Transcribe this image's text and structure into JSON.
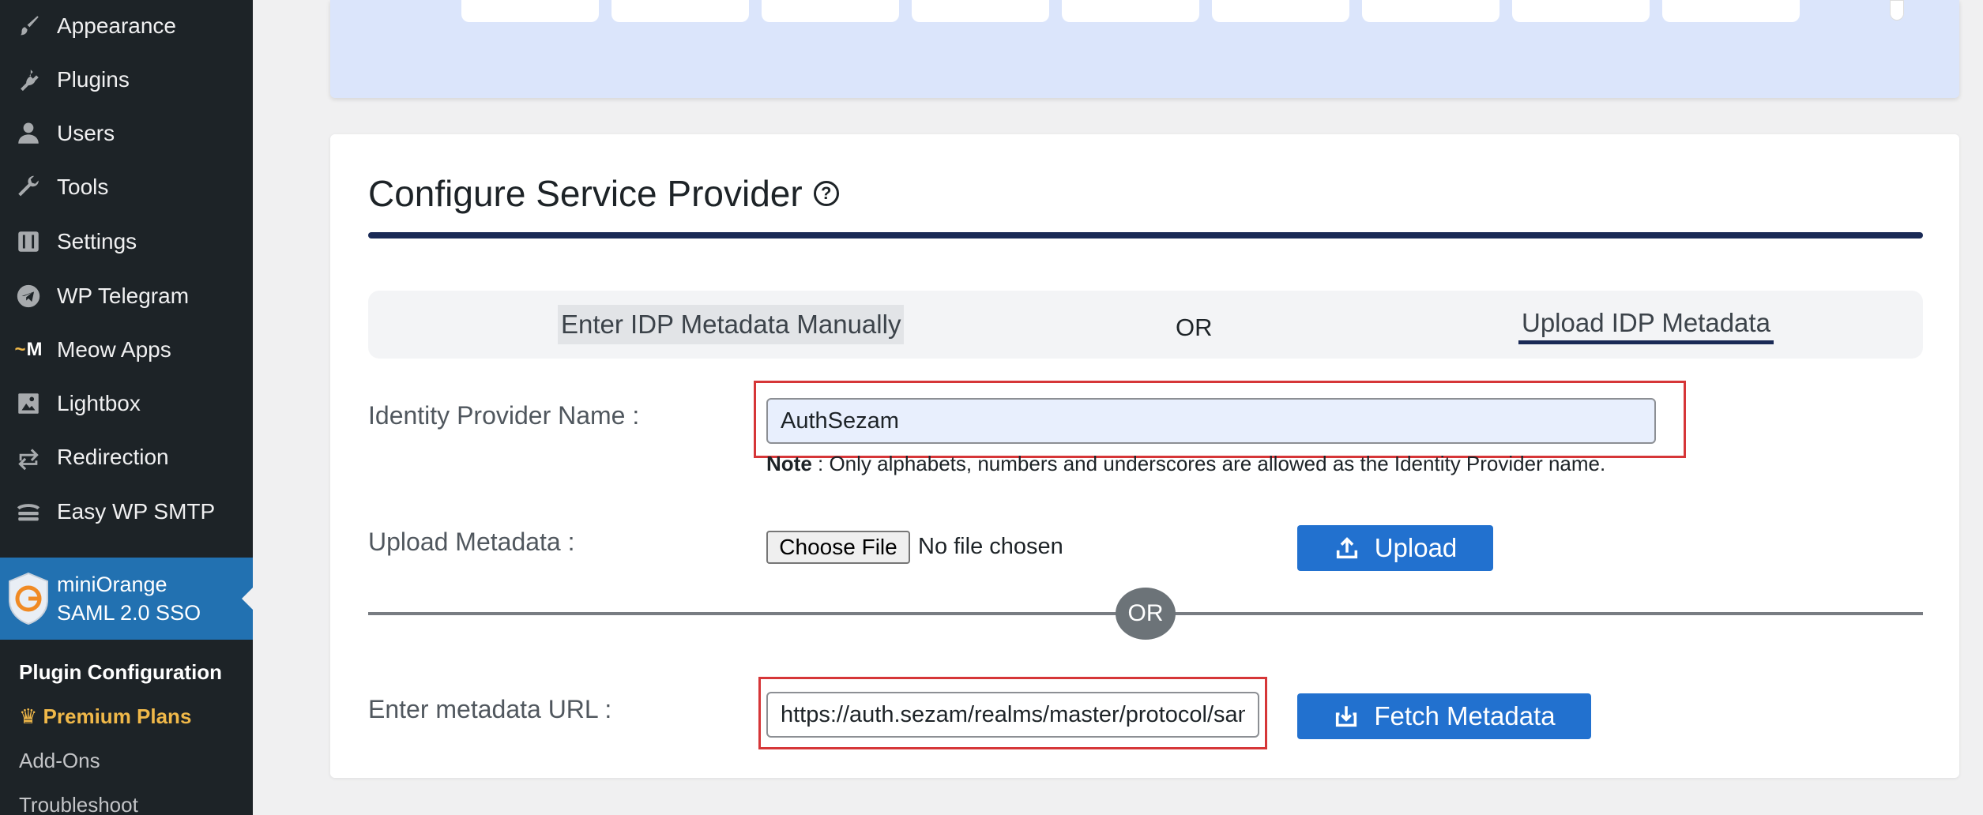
{
  "sidebar": {
    "items": [
      {
        "label": "Appearance",
        "icon": "brush-icon"
      },
      {
        "label": "Plugins",
        "icon": "plugin-icon"
      },
      {
        "label": "Users",
        "icon": "users-icon"
      },
      {
        "label": "Tools",
        "icon": "wrench-icon"
      },
      {
        "label": "Settings",
        "icon": "settings-icon"
      },
      {
        "label": "WP Telegram",
        "icon": "telegram-icon"
      },
      {
        "label": "Meow Apps",
        "icon": "meow-icon"
      },
      {
        "label": "Lightbox",
        "icon": "image-icon"
      },
      {
        "label": "Redirection",
        "icon": "redirect-icon"
      },
      {
        "label": "Easy WP SMTP",
        "icon": "mail-icon"
      }
    ],
    "active_item": {
      "line1": "miniOrange",
      "line2": "SAML 2.0 SSO"
    },
    "submenu": {
      "plugin_configuration": "Plugin Configuration",
      "premium_plans": "Premium Plans",
      "add_ons": "Add-Ons",
      "troubleshoot": "Troubleshoot"
    }
  },
  "main": {
    "title": "Configure Service Provider",
    "help_glyph": "?",
    "tabs": {
      "manual": "Enter IDP Metadata Manually",
      "or": "OR",
      "upload": "Upload IDP Metadata"
    },
    "idp_name": {
      "label": "Identity Provider Name :",
      "value": "AuthSezam",
      "note_bold": "Note",
      "note_text": " : Only alphabets, numbers and underscores are allowed as the Identity Provider name."
    },
    "upload": {
      "label": "Upload Metadata :",
      "choose_file": "Choose File",
      "no_file": "No file chosen",
      "button": "Upload"
    },
    "divider_or": "OR",
    "metadata_url": {
      "label": "Enter metadata URL :",
      "value": "https://auth.sezam/realms/master/protocol/saml/descriptor",
      "button": "Fetch Metadata"
    }
  },
  "colors": {
    "sidebar_bg": "#1d2327",
    "active_menu": "#2271b1",
    "primary_button": "#2271cf",
    "highlight_border": "#d63638",
    "title_rule": "#1a2a56"
  }
}
